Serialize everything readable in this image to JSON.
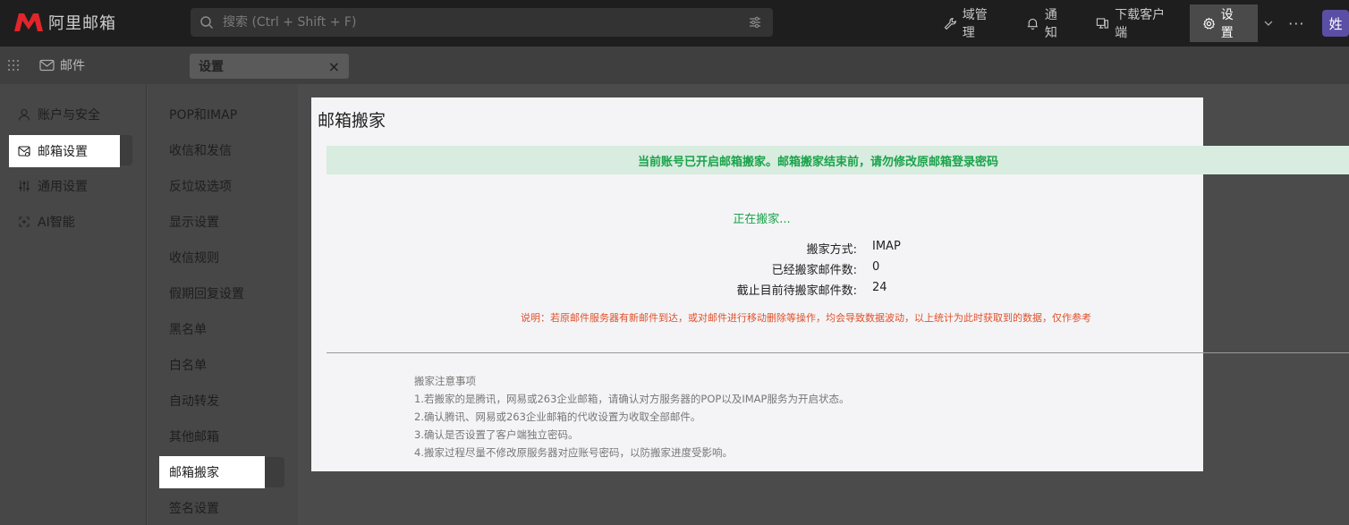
{
  "app": {
    "logo_text": "阿里邮箱",
    "brand_color": "#e0262b"
  },
  "search": {
    "placeholder": "搜索 (Ctrl + Shift + F)"
  },
  "topbar": {
    "domain_mgmt": "域管理",
    "notify": "通知",
    "download": "下载客户端",
    "settings": "设置",
    "more": "···",
    "avatar": "姓"
  },
  "tabs": {
    "mail": "邮件",
    "settings": "设置",
    "close": "×"
  },
  "leftnav": {
    "items": [
      {
        "label": "账户与安全",
        "icon": "user-icon"
      },
      {
        "label": "邮箱设置",
        "icon": "mailbox-settings-icon"
      },
      {
        "label": "通用设置",
        "icon": "sliders-icon"
      },
      {
        "label": "AI智能",
        "icon": "ai-icon"
      }
    ]
  },
  "subnav": {
    "items": [
      "POP和IMAP",
      "收信和发信",
      "反垃圾选项",
      "显示设置",
      "收信规则",
      "假期回复设置",
      "黑名单",
      "白名单",
      "自动转发",
      "其他邮箱",
      "邮箱搬家",
      "签名设置"
    ]
  },
  "dialog": {
    "title": "邮箱搬家",
    "banner": "当前账号已开启邮箱搬家。邮箱搬家结束前，请勿修改原邮箱登录密码",
    "status": "正在搬家...",
    "method_label": "搬家方式:",
    "method_value": "IMAP",
    "moved_label": "已经搬家邮件数:",
    "moved_value": "0",
    "pending_label": "截止目前待搬家邮件数:",
    "pending_value": "24",
    "note": "说明：若原邮件服务器有新邮件到达，或对邮件进行移动删除等操作，均会导致数据波动，以上统计为此时获取到的数据，仅作参考",
    "tips_title": "搬家注意事项",
    "tips": [
      "1.若搬家的是腾讯，网易或263企业邮箱，请确认对方服务器的POP以及IMAP服务为开启状态。",
      "2.确认腾讯、网易或263企业邮箱的代收设置为收取全部邮件。",
      "3.确认是否设置了客户端独立密码。",
      "4.搬家过程尽量不修改原服务器对应账号密码，以防搬家进度受影响。"
    ]
  },
  "colors": {
    "success_green": "#1aa34a",
    "warning_orange": "#e0502a",
    "banner_bg": "#d8ecdf",
    "avatar_bg": "#5b4ea5"
  }
}
